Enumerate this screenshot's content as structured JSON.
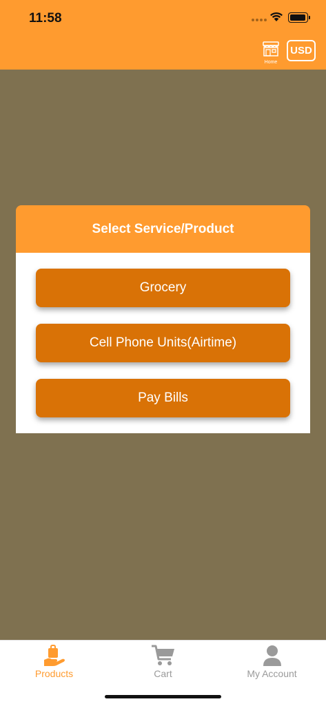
{
  "status_bar": {
    "time": "11:58"
  },
  "header": {
    "home_label": "Home",
    "currency_label": "USD",
    "color": "#ff9b2f"
  },
  "dialog": {
    "title": "Select Service/Product",
    "buttons": [
      {
        "label": "Grocery"
      },
      {
        "label": "Cell Phone Units(Airtime)"
      },
      {
        "label": "Pay Bills"
      }
    ],
    "button_color": "#d97206"
  },
  "tabbar": {
    "tabs": [
      {
        "label": "Products",
        "icon": "shopping-bag-hand-icon",
        "active": true
      },
      {
        "label": "Cart",
        "icon": "cart-icon",
        "active": false
      },
      {
        "label": "My Account",
        "icon": "user-icon",
        "active": false
      }
    ]
  }
}
